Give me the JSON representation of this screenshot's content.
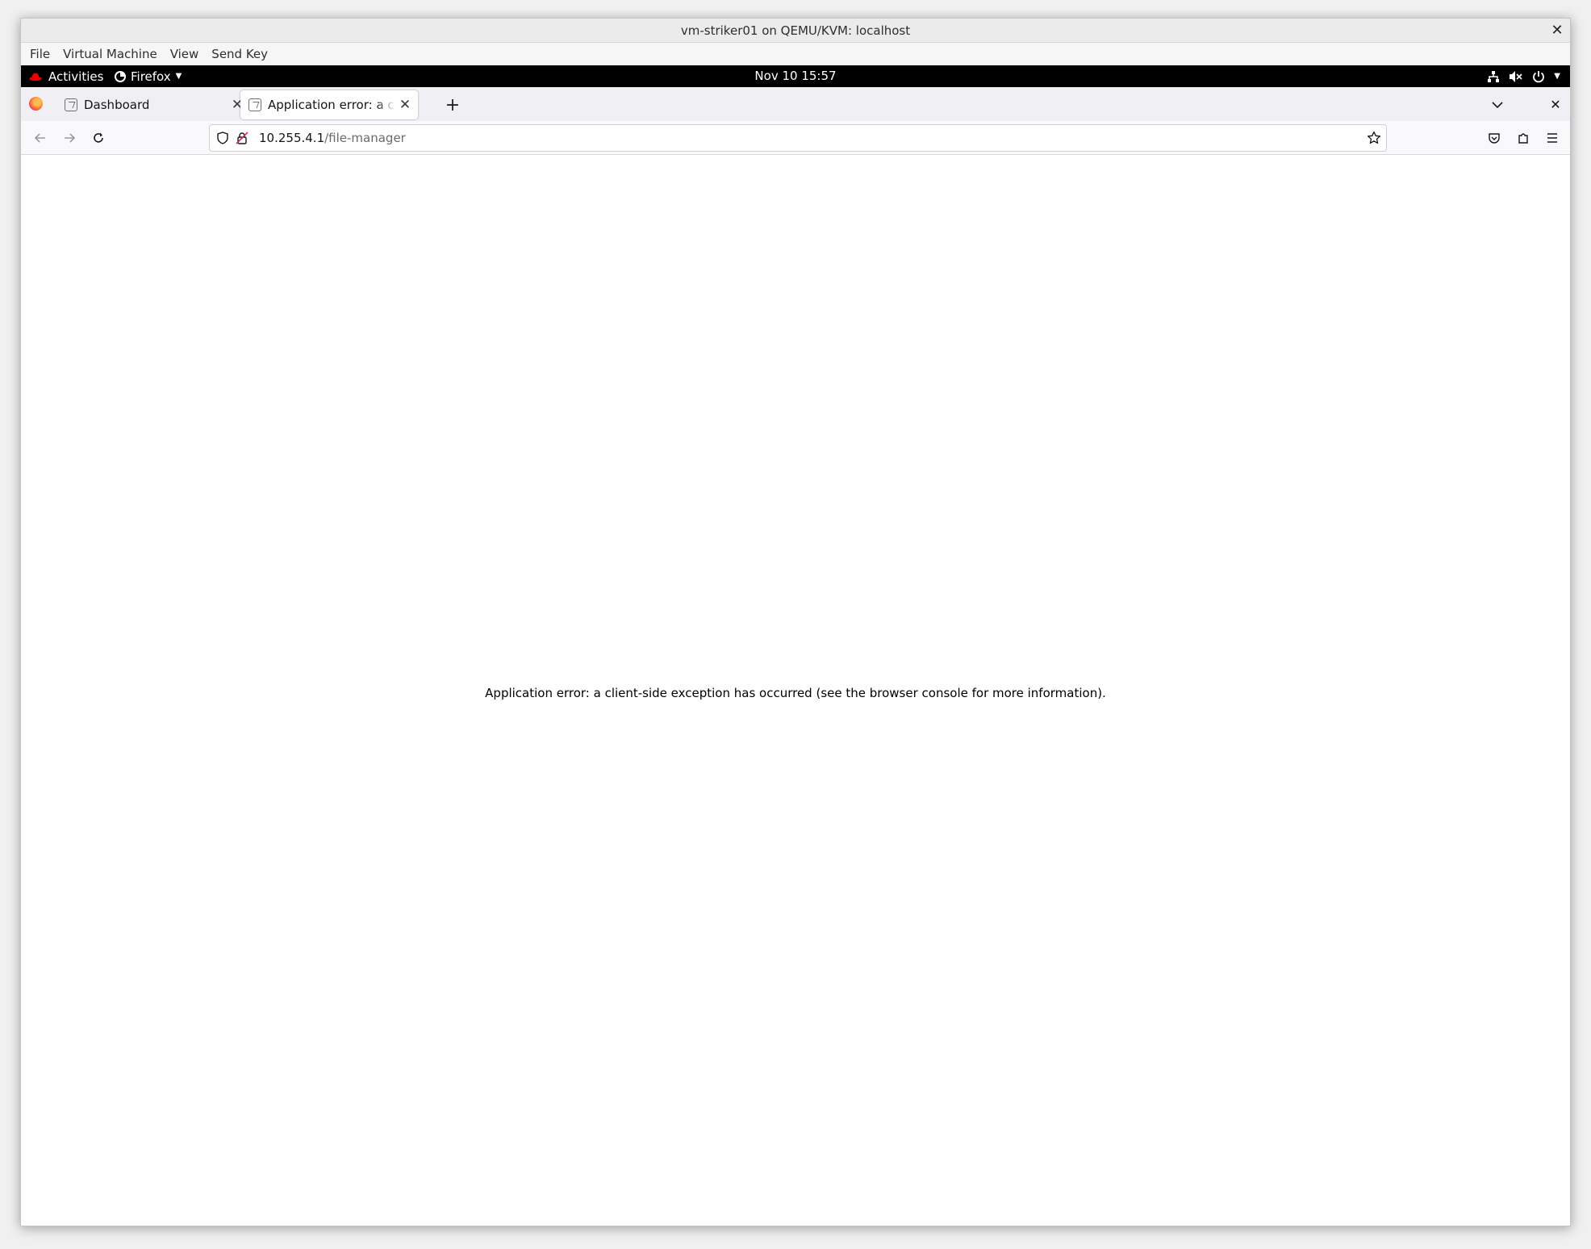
{
  "window": {
    "title": "vm-striker01 on QEMU/KVM: localhost",
    "close_glyph": "✕"
  },
  "menubar": {
    "items": [
      "File",
      "Virtual Machine",
      "View",
      "Send Key"
    ]
  },
  "gnome": {
    "activities_label": "Activities",
    "app_label": "Firefox",
    "clock": "Nov 10  15:57",
    "tray_icons": [
      "network-icon",
      "volume-muted-icon",
      "power-icon"
    ]
  },
  "tabs": {
    "items": [
      {
        "label": "Dashboard",
        "active": false
      },
      {
        "label": "Application error: a client-side exception has occurred",
        "active": true
      }
    ],
    "new_tab_glyph": "+",
    "close_glyph": "✕"
  },
  "navbar": {
    "url_host": "10.255.4.1",
    "url_path": "/file-manager"
  },
  "content": {
    "error_message": "Application error: a client-side exception has occurred (see the browser console for more information)."
  },
  "colors": {
    "gnome_bar": "#000000",
    "tab_strip": "#f0f0f4",
    "toolbar": "#f9f9fb",
    "redhat_red": "#ee0000"
  }
}
